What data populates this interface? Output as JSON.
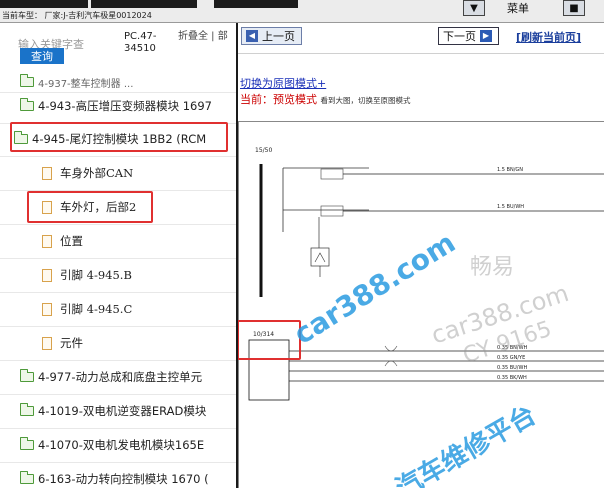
{
  "header": {
    "vehicle_label": "当前车型：",
    "vehicle_name": "厂家:J-吉利汽车极星0012024",
    "menu_label": "菜单",
    "menu_icon_left": "arrow-down-icon",
    "menu_icon_right": "expand-icon"
  },
  "search": {
    "placeholder": "输入关键字查",
    "button_label": "查询",
    "pc_code": "PC.47-34510",
    "collapse_all": "折叠全 | 部"
  },
  "tree": {
    "items": [
      {
        "label": "4-943-高压增压变频器模块 1697",
        "type": "folder"
      },
      {
        "label": "4-945-尾灯控制模块 1BB2 (RCM",
        "type": "folder-open"
      },
      {
        "label": "车身外部CAN",
        "type": "doc"
      },
      {
        "label": "车外灯，后部2",
        "type": "doc"
      },
      {
        "label": "位置",
        "type": "doc"
      },
      {
        "label": "引脚 4-945.B",
        "type": "doc"
      },
      {
        "label": "引脚 4-945.C",
        "type": "doc"
      },
      {
        "label": "元件",
        "type": "doc"
      },
      {
        "label": "4-977-动力总成和底盘主控单元",
        "type": "folder"
      },
      {
        "label": "4-1019-双电机逆变器ERAD模块",
        "type": "folder"
      },
      {
        "label": "4-1070-双电机发电机模块165E",
        "type": "folder"
      },
      {
        "label": "6-163-动力转向控制模块 1670 (",
        "type": "folder"
      }
    ]
  },
  "nav": {
    "prev_label": "上一页",
    "next_label": "下一页",
    "refresh_label": "[刷新当前页]"
  },
  "content": {
    "switch_link": "切换为原图模式+",
    "current_label": "当前：",
    "current_mode": "预览模式",
    "current_hint": "看到大图，切换至原图模式"
  },
  "diagram": {
    "connector_top": "15/50",
    "connector_bottom": "10/314",
    "wires_top": [
      "1.5 BN/GN",
      "1.5 BU/WH"
    ],
    "wires_bottom": [
      "0.35 BN/WH",
      "0.35 GN/YE",
      "0.35 BU/WH",
      "0.35 BK/WH"
    ]
  },
  "watermark": {
    "text1": "car388.com",
    "text2": "畅易",
    "text3": "car388.com",
    "text4": "CY 9165",
    "text5": "汽车维修平台"
  },
  "colors": {
    "accent": "#1a73c9",
    "highlight": "#e03030",
    "watermark": "#2a9be0"
  }
}
